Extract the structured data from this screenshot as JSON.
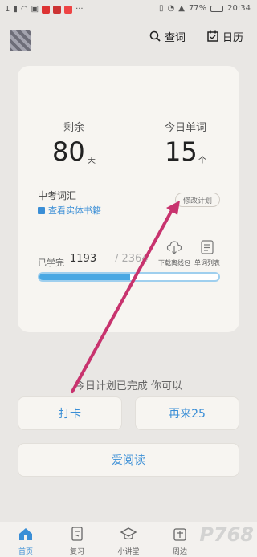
{
  "status_bar": {
    "app_badge": "1",
    "battery": "77%",
    "time": "20:34"
  },
  "header": {
    "search_label": "查词",
    "calendar_label": "日历"
  },
  "plan_card": {
    "remaining_label": "剩余",
    "remaining_value": "80",
    "remaining_unit": "天",
    "today_label": "今日单词",
    "today_value": "15",
    "today_unit": "个",
    "book_name": "中考词汇",
    "book_link": "查看实体书籍",
    "modify_button": "修改计划",
    "learned_label": "已学完",
    "learned_count": "1193",
    "learned_total": "/ 2364",
    "learned_progress": 0.505,
    "offline_label": "下载离线包",
    "wordlist_label": "单词列表"
  },
  "completion_text": "今日计划已完成 你可以",
  "actions": {
    "checkin": "打卡",
    "again": "再来25",
    "read": "爱阅读"
  },
  "tabs": [
    {
      "label": "首页",
      "icon": "home-icon"
    },
    {
      "label": "复习",
      "icon": "review-icon"
    },
    {
      "label": "小讲堂",
      "icon": "lecture-icon"
    },
    {
      "label": "周边",
      "icon": "shop-icon"
    }
  ],
  "watermark": "P768",
  "colors": {
    "accent": "#3a8ed6",
    "progress": "#4aa8e3",
    "annotation": "#c8336e"
  }
}
